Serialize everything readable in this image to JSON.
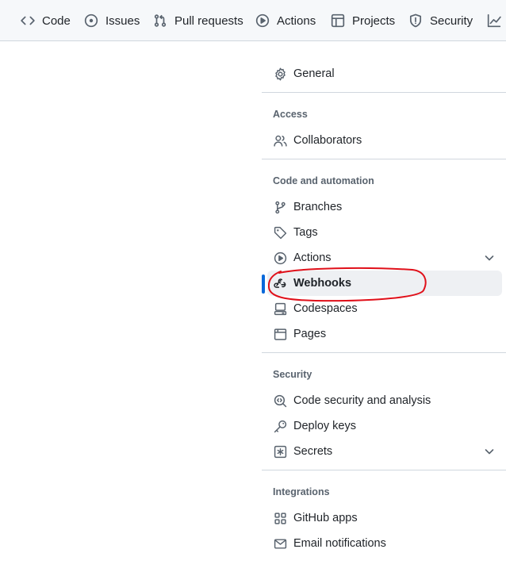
{
  "topnav": {
    "tabs": [
      {
        "label": "Code",
        "icon": "code-icon"
      },
      {
        "label": "Issues",
        "icon": "issue-opened-icon"
      },
      {
        "label": "Pull requests",
        "icon": "git-pull-request-icon"
      },
      {
        "label": "Actions",
        "icon": "play-icon"
      },
      {
        "label": "Projects",
        "icon": "table-icon"
      },
      {
        "label": "Security",
        "icon": "shield-icon"
      },
      {
        "label": "",
        "icon": "graph-icon"
      }
    ]
  },
  "sidebar": {
    "general": {
      "label": "General",
      "icon": "gear-icon"
    },
    "sections": [
      {
        "heading": "Access",
        "items": [
          {
            "label": "Collaborators",
            "icon": "people-icon"
          }
        ]
      },
      {
        "heading": "Code and automation",
        "items": [
          {
            "label": "Branches",
            "icon": "git-branch-icon"
          },
          {
            "label": "Tags",
            "icon": "tag-icon"
          },
          {
            "label": "Actions",
            "icon": "play-icon",
            "expandable": true
          },
          {
            "label": "Webhooks",
            "icon": "webhook-icon",
            "selected": true
          },
          {
            "label": "Codespaces",
            "icon": "codespaces-icon"
          },
          {
            "label": "Pages",
            "icon": "browser-icon"
          }
        ]
      },
      {
        "heading": "Security",
        "items": [
          {
            "label": "Code security and analysis",
            "icon": "codescan-icon"
          },
          {
            "label": "Deploy keys",
            "icon": "key-icon"
          },
          {
            "label": "Secrets",
            "icon": "asterisk-icon",
            "expandable": true
          }
        ]
      },
      {
        "heading": "Integrations",
        "items": [
          {
            "label": "GitHub apps",
            "icon": "apps-icon"
          },
          {
            "label": "Email notifications",
            "icon": "mail-icon"
          }
        ]
      }
    ]
  },
  "colors": {
    "accent": "#0969da",
    "annotation": "#e0101a",
    "nav_bg": "#f6f8fa",
    "selected_bg": "#eef0f3"
  }
}
